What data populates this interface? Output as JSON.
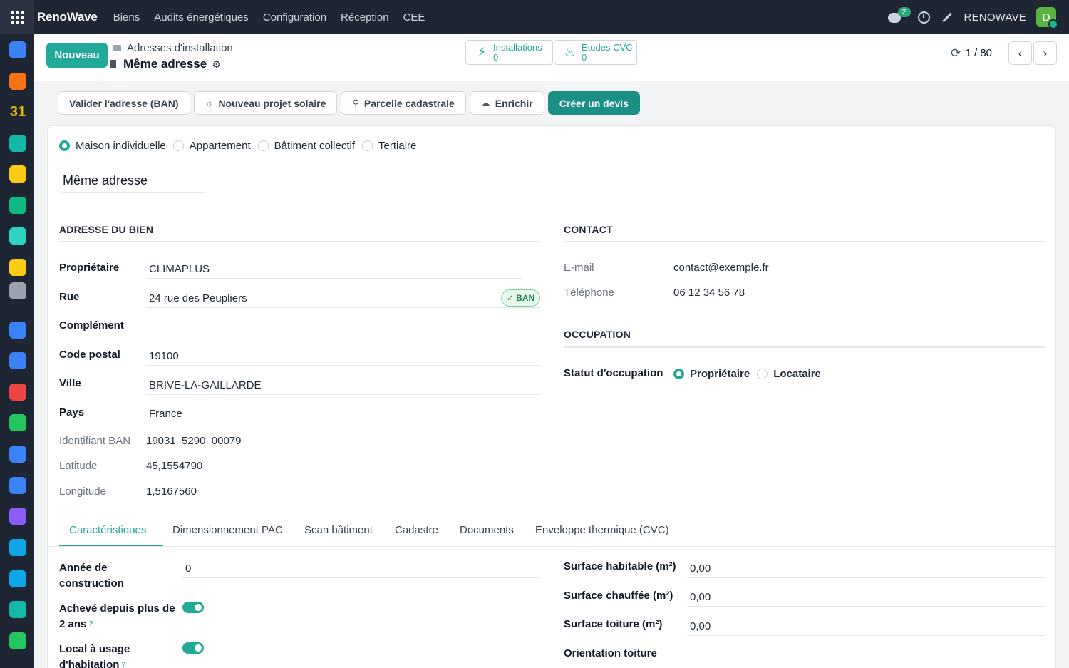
{
  "topbar": {
    "brand": "RenoWave",
    "menu": [
      "Biens",
      "Audits énergétiques",
      "Configuration",
      "Réception",
      "CEE"
    ],
    "chat_badge": "2",
    "company": "RENOWAVE",
    "avatar_initial": "D"
  },
  "rail_icons": [
    {
      "name": "app-icon-1",
      "color": "#3b82f6"
    },
    {
      "name": "app-icon-2",
      "color": "#f97316"
    },
    {
      "name": "calendar-31-icon",
      "color": "#eab308",
      "text": "31"
    },
    {
      "name": "app-icon-4",
      "color": "#14b8a6"
    },
    {
      "name": "app-icon-5",
      "color": "#facc15"
    },
    {
      "name": "contacts-icon",
      "color": "#10b981"
    },
    {
      "name": "app-icon-7",
      "color": "#2dd4bf"
    },
    {
      "name": "app-icon-8",
      "color": "#facc15"
    },
    {
      "name": "bank-icon",
      "color": "#9ca3af"
    },
    {
      "name": "app-icon-10",
      "color": "#3b82f6"
    },
    {
      "name": "calendar-icon",
      "color": "#3b82f6"
    },
    {
      "name": "dashboard-icon",
      "color": "#ef4444"
    },
    {
      "name": "app-icon-13",
      "color": "#22c55e"
    },
    {
      "name": "planning-icon",
      "color": "#3b82f6"
    },
    {
      "name": "app-icon-15",
      "color": "#3b82f6"
    },
    {
      "name": "app-icon-16",
      "color": "#8b5cf6"
    },
    {
      "name": "app-icon-17",
      "color": "#0ea5e9"
    },
    {
      "name": "app-icon-18",
      "color": "#0ea5e9"
    },
    {
      "name": "app-icon-19",
      "color": "#14b8a6"
    },
    {
      "name": "app-icon-20",
      "color": "#22c55e"
    }
  ],
  "control": {
    "new_button": "Nouveau",
    "breadcrumb_parent": "Adresses d'installation",
    "record_title": "Même adresse",
    "smart_buttons": [
      {
        "label": "Installations",
        "count": "0"
      },
      {
        "label": "Études CVC",
        "count": "0"
      }
    ],
    "pager": "1 / 80"
  },
  "actions": [
    {
      "label": "Valider l'adresse (BAN)",
      "icon": ""
    },
    {
      "label": "Nouveau projet solaire",
      "icon": "☼"
    },
    {
      "label": "Parcelle cadastrale",
      "icon": "⚲"
    },
    {
      "label": "Enrichir",
      "icon": "☁"
    },
    {
      "label": "Créer un devis",
      "icon": ""
    }
  ],
  "building_types": [
    {
      "label": "Maison individuelle",
      "selected": true
    },
    {
      "label": "Appartement",
      "selected": false
    },
    {
      "label": "Bâtiment collectif",
      "selected": false
    },
    {
      "label": "Tertiaire",
      "selected": false
    }
  ],
  "name_value": "Même adresse",
  "address": {
    "section_title": "ADRESSE DU BIEN",
    "fields": [
      {
        "label": "Propriétaire",
        "value": "CLIMAPLUS"
      },
      {
        "label": "Rue",
        "value": "24 rue des Peupliers"
      },
      {
        "label": "Complément",
        "value": ""
      },
      {
        "label": "Code postal",
        "value": "19100"
      },
      {
        "label": "Ville",
        "value": "BRIVE-LA-GAILLARDE"
      },
      {
        "label": "Pays",
        "value": "France"
      }
    ],
    "ban_badge": "✓ BAN",
    "readonly": [
      {
        "label": "Identifiant BAN",
        "value": "19031_5290_00079"
      },
      {
        "label": "Latitude",
        "value": "45,1554790"
      },
      {
        "label": "Longitude",
        "value": "1,5167560"
      }
    ]
  },
  "contact": {
    "section_title": "CONTACT",
    "fields": [
      {
        "label": "E-mail",
        "value": "contact@exemple.fr"
      },
      {
        "label": "Téléphone",
        "value": "06 12 34 56 78"
      }
    ]
  },
  "occupation": {
    "section_title": "OCCUPATION",
    "label": "Statut d'occupation",
    "options": [
      {
        "label": "Propriétaire",
        "selected": true
      },
      {
        "label": "Locataire",
        "selected": false
      }
    ]
  },
  "tabs": [
    "Caractéristiques",
    "Dimensionnement PAC",
    "Scan bâtiment",
    "Cadastre",
    "Documents",
    "Enveloppe thermique (CVC)"
  ],
  "characteristics": {
    "year_label_1": "Année de",
    "year_label_2": "construction",
    "year_value": "0",
    "achieved_label_1": "Achevé depuis plus de",
    "achieved_label_2": "2 ans",
    "achieved_on": true,
    "local_label_1": "Local à usage",
    "local_label_2": "d'habitation",
    "local_on": true,
    "help_mark": "?",
    "right": [
      {
        "label": "Surface habitable (m²)",
        "value": "0,00"
      },
      {
        "label": "Surface chauffée (m²)",
        "value": "0,00"
      },
      {
        "label": "Surface toiture (m²)",
        "value": "0,00"
      },
      {
        "label": "Orientation toiture",
        "value": ""
      }
    ]
  }
}
